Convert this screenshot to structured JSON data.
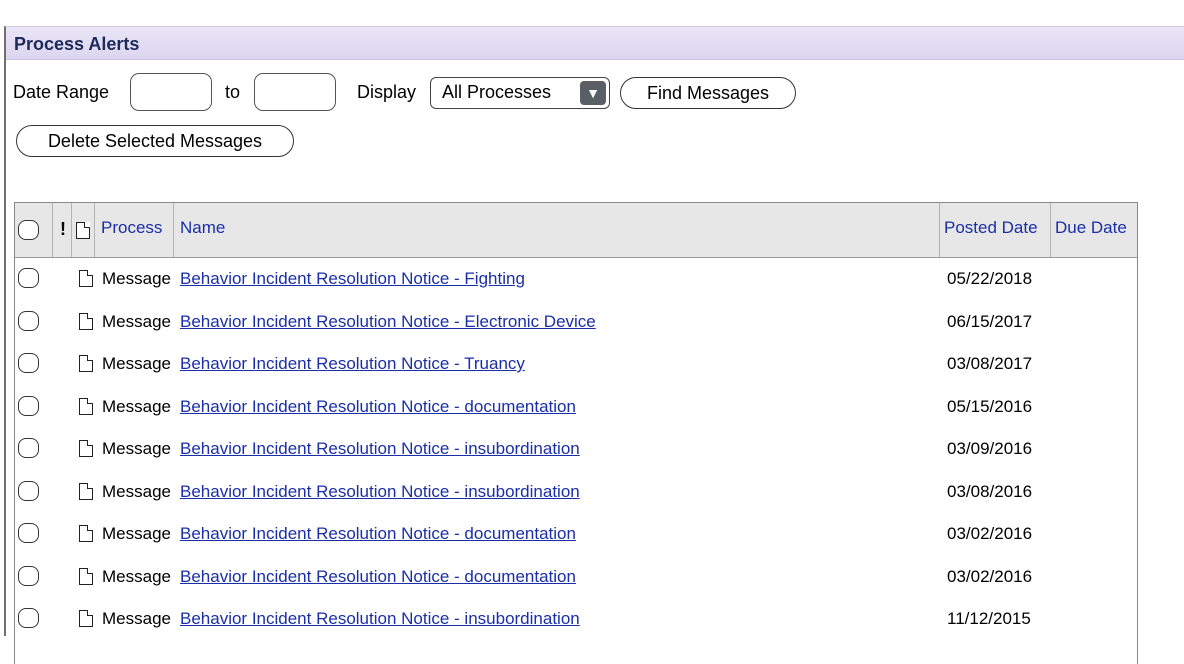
{
  "panel": {
    "title": "Process Alerts"
  },
  "filters": {
    "date_range_label": "Date Range",
    "to_label": "to",
    "from_value": "",
    "to_value": "",
    "display_label": "Display",
    "display_selected": "All Processes",
    "find_button": "Find Messages",
    "delete_button": "Delete Selected Messages"
  },
  "table": {
    "columns": {
      "process": "Process",
      "name": "Name",
      "posted_date": "Posted Date",
      "due_date": "Due Date",
      "priority_glyph": "!"
    },
    "rows": [
      {
        "process": "Message",
        "name": "Behavior Incident Resolution Notice - Fighting",
        "posted_date": "05/22/2018",
        "due_date": ""
      },
      {
        "process": "Message",
        "name": "Behavior Incident Resolution Notice - Electronic Device",
        "posted_date": "06/15/2017",
        "due_date": ""
      },
      {
        "process": "Message",
        "name": "Behavior Incident Resolution Notice - Truancy",
        "posted_date": "03/08/2017",
        "due_date": ""
      },
      {
        "process": "Message",
        "name": "Behavior Incident Resolution Notice - documentation",
        "posted_date": "05/15/2016",
        "due_date": ""
      },
      {
        "process": "Message",
        "name": "Behavior Incident Resolution Notice - insubordination",
        "posted_date": "03/09/2016",
        "due_date": ""
      },
      {
        "process": "Message",
        "name": "Behavior Incident Resolution Notice - insubordination",
        "posted_date": "03/08/2016",
        "due_date": ""
      },
      {
        "process": "Message",
        "name": "Behavior Incident Resolution Notice - documentation",
        "posted_date": "03/02/2016",
        "due_date": ""
      },
      {
        "process": "Message",
        "name": "Behavior Incident Resolution Notice - documentation",
        "posted_date": "03/02/2016",
        "due_date": ""
      },
      {
        "process": "Message",
        "name": "Behavior Incident Resolution Notice - insubordination",
        "posted_date": "11/12/2015",
        "due_date": ""
      }
    ]
  },
  "icons": {
    "checkbox": "rounded-checkbox-icon",
    "priority": "exclamation-icon",
    "attachment": "document-icon",
    "dropdown": "triangle-down-icon"
  },
  "colors": {
    "header_bar": "#dcd6f0",
    "link": "#1a2ea8",
    "table_header": "#e7e7e7"
  }
}
